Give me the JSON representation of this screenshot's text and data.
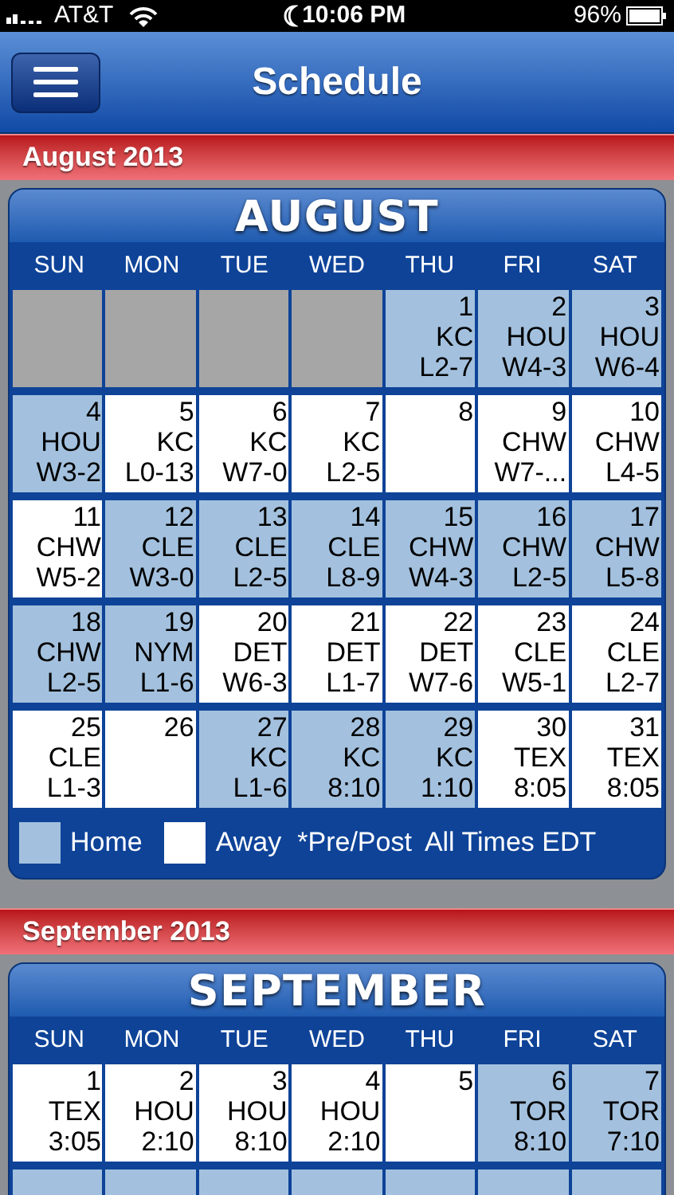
{
  "status_bar": {
    "carrier": "AT&T",
    "time": "10:06 PM",
    "battery": "96%"
  },
  "nav": {
    "title": "Schedule"
  },
  "months": [
    {
      "header": "August 2013",
      "title": "AUGUST",
      "weekdays": [
        "SUN",
        "MON",
        "TUE",
        "WED",
        "THU",
        "FRI",
        "SAT"
      ],
      "weeks": [
        [
          {
            "kind": "empty"
          },
          {
            "kind": "empty"
          },
          {
            "kind": "empty"
          },
          {
            "kind": "empty"
          },
          {
            "kind": "home",
            "day": "1",
            "opponent": "KC",
            "result": "L2-7"
          },
          {
            "kind": "home",
            "day": "2",
            "opponent": "HOU",
            "result": "W4-3"
          },
          {
            "kind": "home",
            "day": "3",
            "opponent": "HOU",
            "result": "W6-4"
          }
        ],
        [
          {
            "kind": "home",
            "day": "4",
            "opponent": "HOU",
            "result": "W3-2"
          },
          {
            "kind": "away",
            "day": "5",
            "opponent": "KC",
            "result": "L0-13"
          },
          {
            "kind": "away",
            "day": "6",
            "opponent": "KC",
            "result": "W7-0"
          },
          {
            "kind": "away",
            "day": "7",
            "opponent": "KC",
            "result": "L2-5"
          },
          {
            "kind": "away",
            "day": "8"
          },
          {
            "kind": "away",
            "day": "9",
            "opponent": "CHW",
            "result": "W7-..."
          },
          {
            "kind": "away",
            "day": "10",
            "opponent": "CHW",
            "result": "L4-5"
          }
        ],
        [
          {
            "kind": "away",
            "day": "11",
            "opponent": "CHW",
            "result": "W5-2"
          },
          {
            "kind": "home",
            "day": "12",
            "opponent": "CLE",
            "result": "W3-0"
          },
          {
            "kind": "home",
            "day": "13",
            "opponent": "CLE",
            "result": "L2-5"
          },
          {
            "kind": "home",
            "day": "14",
            "opponent": "CLE",
            "result": "L8-9"
          },
          {
            "kind": "home",
            "day": "15",
            "opponent": "CHW",
            "result": "W4-3"
          },
          {
            "kind": "home",
            "day": "16",
            "opponent": "CHW",
            "result": "L2-5"
          },
          {
            "kind": "home",
            "day": "17",
            "opponent": "CHW",
            "result": "L5-8"
          }
        ],
        [
          {
            "kind": "home",
            "day": "18",
            "opponent": "CHW",
            "result": "L2-5"
          },
          {
            "kind": "home",
            "day": "19",
            "opponent": "NYM",
            "result": "L1-6"
          },
          {
            "kind": "away",
            "day": "20",
            "opponent": "DET",
            "result": "W6-3"
          },
          {
            "kind": "away",
            "day": "21",
            "opponent": "DET",
            "result": "L1-7"
          },
          {
            "kind": "away",
            "day": "22",
            "opponent": "DET",
            "result": "W7-6"
          },
          {
            "kind": "away",
            "day": "23",
            "opponent": "CLE",
            "result": "W5-1"
          },
          {
            "kind": "away",
            "day": "24",
            "opponent": "CLE",
            "result": "L2-7"
          }
        ],
        [
          {
            "kind": "away",
            "day": "25",
            "opponent": "CLE",
            "result": "L1-3"
          },
          {
            "kind": "away",
            "day": "26"
          },
          {
            "kind": "home",
            "day": "27",
            "opponent": "KC",
            "result": "L1-6"
          },
          {
            "kind": "home",
            "day": "28",
            "opponent": "KC",
            "result": "8:10"
          },
          {
            "kind": "home",
            "day": "29",
            "opponent": "KC",
            "result": "1:10"
          },
          {
            "kind": "away",
            "day": "30",
            "opponent": "TEX",
            "result": "8:05"
          },
          {
            "kind": "away",
            "day": "31",
            "opponent": "TEX",
            "result": "8:05"
          }
        ]
      ],
      "legend": {
        "home": "Home",
        "away": "Away",
        "note": "*Pre/Post",
        "timezone": "All Times EDT"
      }
    },
    {
      "header": "September 2013",
      "title": "SEPTEMBER",
      "weekdays": [
        "SUN",
        "MON",
        "TUE",
        "WED",
        "THU",
        "FRI",
        "SAT"
      ],
      "weeks": [
        [
          {
            "kind": "away",
            "day": "1",
            "opponent": "TEX",
            "result": "3:05"
          },
          {
            "kind": "away",
            "day": "2",
            "opponent": "HOU",
            "result": "2:10"
          },
          {
            "kind": "away",
            "day": "3",
            "opponent": "HOU",
            "result": "8:10"
          },
          {
            "kind": "away",
            "day": "4",
            "opponent": "HOU",
            "result": "2:10"
          },
          {
            "kind": "away",
            "day": "5"
          },
          {
            "kind": "home",
            "day": "6",
            "opponent": "TOR",
            "result": "8:10"
          },
          {
            "kind": "home",
            "day": "7",
            "opponent": "TOR",
            "result": "7:10"
          }
        ],
        [
          {
            "kind": "home"
          },
          {
            "kind": "home"
          },
          {
            "kind": "home"
          },
          {
            "kind": "home"
          },
          {
            "kind": "home"
          },
          {
            "kind": "home"
          },
          {
            "kind": "home"
          }
        ]
      ]
    }
  ]
}
